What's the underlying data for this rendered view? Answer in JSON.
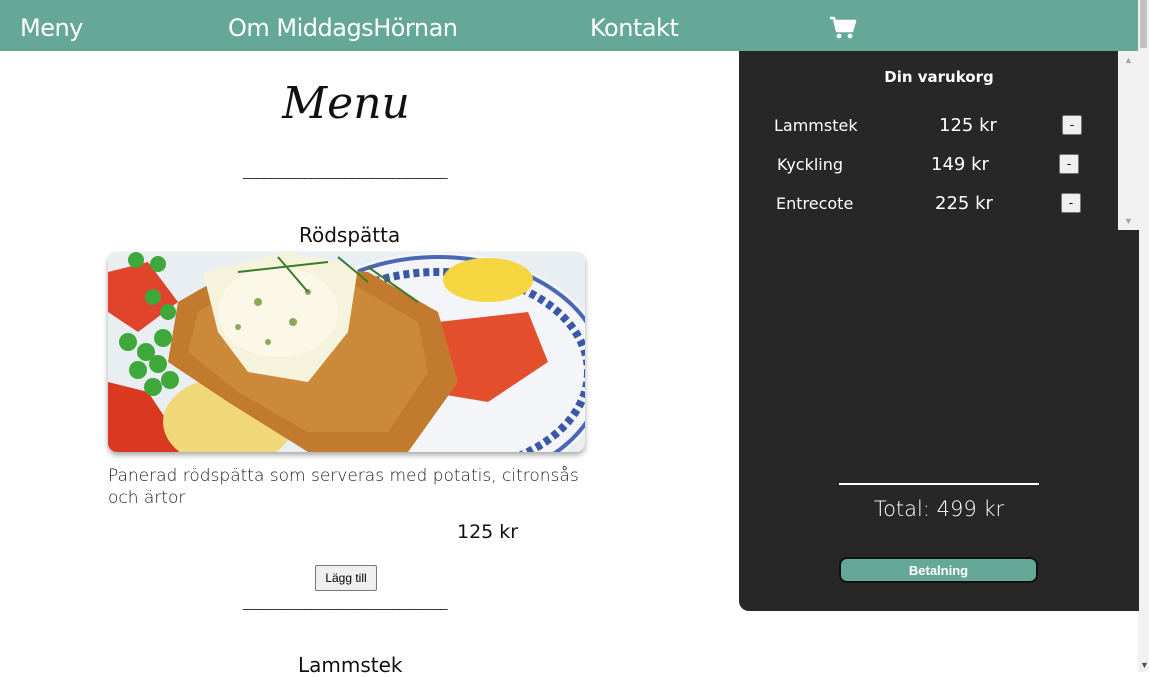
{
  "nav": {
    "items": [
      {
        "label": "Meny"
      },
      {
        "label": "Om MiddagsHörnan"
      },
      {
        "label": "Kontakt"
      }
    ],
    "cart_icon": "shopping-cart-icon"
  },
  "menu": {
    "title": "Menu",
    "divider": "______________________________",
    "dishes": [
      {
        "name": "Rödspätta",
        "description": "Panerad rödspätta som serveras med potatis, citronsås och ärtor",
        "price": "125 kr",
        "add_label": "Lägg till"
      },
      {
        "name": "Lammstek"
      }
    ]
  },
  "cart": {
    "title": "Din varukorg",
    "items": [
      {
        "name": "Lammstek",
        "price": "125 kr",
        "remove_label": "-"
      },
      {
        "name": "Kyckling",
        "price": "149 kr",
        "remove_label": "-"
      },
      {
        "name": "Entrecote",
        "price": "225 kr",
        "remove_label": "-"
      }
    ],
    "total": "Total: 499 kr",
    "pay_label": "Betalning"
  },
  "colors": {
    "accent": "#65a897",
    "cart_bg": "#272727"
  }
}
